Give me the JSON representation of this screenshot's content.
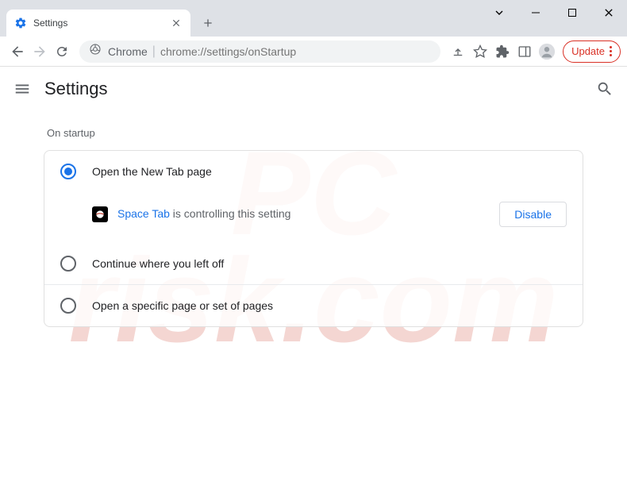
{
  "watermark": {
    "line1": "PC",
    "line2": "risk.com"
  },
  "tab": {
    "title": "Settings"
  },
  "omnibox": {
    "origin": "Chrome",
    "path": "chrome://settings/onStartup"
  },
  "toolbar": {
    "update_label": "Update"
  },
  "header": {
    "title": "Settings"
  },
  "section": {
    "label": "On startup"
  },
  "options": {
    "opt1": "Open the New Tab page",
    "opt2": "Continue where you left off",
    "opt3": "Open a specific page or set of pages"
  },
  "extension": {
    "name": "Space Tab",
    "message": " is controlling this setting",
    "disable_label": "Disable"
  }
}
